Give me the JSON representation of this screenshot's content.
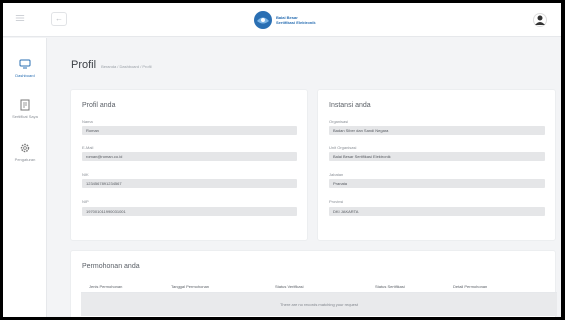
{
  "header": {
    "logo_text": "Balai Besar Sertifikasi Elektronik",
    "title": "Profil",
    "breadcrumb": "Beranda  /  Dashboard  /  Profil"
  },
  "sidebar": {
    "items": [
      {
        "label": "Dashboard",
        "icon": "monitor-icon",
        "active": true
      },
      {
        "label": "Sertifikat Saya",
        "icon": "certificate-icon",
        "active": false
      },
      {
        "label": "Pengaturan",
        "icon": "gear-icon",
        "active": false
      }
    ]
  },
  "profile": {
    "title": "Profil anda",
    "fields": [
      {
        "label": "Nama",
        "value": "Roman"
      },
      {
        "label": "E-Mail",
        "value": "roman@roman.co.id"
      },
      {
        "label": "NIK",
        "value": "1234567891234567"
      },
      {
        "label": "NIP",
        "value": "197001011990031001"
      }
    ]
  },
  "institution": {
    "title": "Instansi anda",
    "fields": [
      {
        "label": "Organisasi",
        "value": "Badan Siber dan Sandi Negara"
      },
      {
        "label": "Unit Organisasi",
        "value": "Balai Besar Sertifikasi Elektronik"
      },
      {
        "label": "Jabatan",
        "value": "Pranata"
      },
      {
        "label": "Provinsi",
        "value": "DKI JAKARTA"
      }
    ]
  },
  "requests": {
    "title": "Permohonan anda",
    "columns": [
      "Jenis Permohonan",
      "Tanggal Permohonan",
      "Status Verifikasi",
      "Status Sertifikasi",
      "Detail Permohonan"
    ],
    "empty_text": "There are no records matching your request"
  },
  "colors": {
    "accent": "#2a6fb3",
    "field_bg": "#e5e6e8",
    "page_bg": "#f3f4f6"
  }
}
